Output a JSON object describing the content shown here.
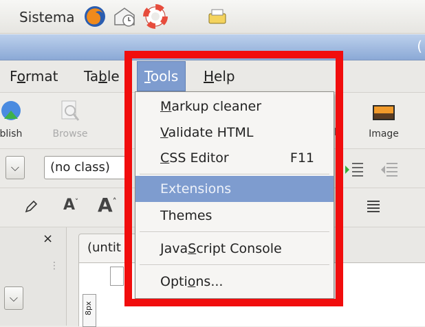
{
  "panel": {
    "system_label": "Sistema",
    "icons": [
      "firefox-icon",
      "mail-clock-icon",
      "lifebuoy-icon",
      "printer-icon"
    ]
  },
  "menubar": {
    "format": {
      "pre": "F",
      "u": "o",
      "post": "rmat"
    },
    "table": {
      "pre": "Ta",
      "u": "b",
      "post": "le"
    },
    "tools": {
      "pre": "",
      "u": "T",
      "post": "ools"
    },
    "help": {
      "pre": "",
      "u": "H",
      "post": "elp"
    }
  },
  "toolbar": {
    "publish_label": "ıblish",
    "browse_label": "Browse",
    "image_label": "Image"
  },
  "format_toolbar": {
    "class_value": "(no class)"
  },
  "tools_menu": {
    "markup_cleaner": {
      "u": "M",
      "post": "arkup cleaner"
    },
    "validate_html": {
      "u": "V",
      "post": "alidate HTML"
    },
    "css_editor": {
      "u": "C",
      "post": "SS Editor",
      "shortcut": "F11"
    },
    "extensions": {
      "label": "Extensions"
    },
    "themes": {
      "label": "Themes"
    },
    "js_console": {
      "pre": "Java",
      "u": "S",
      "post": "cript Console"
    },
    "options": {
      "pre": "Opti",
      "u": "o",
      "post": "ns..."
    }
  },
  "editor": {
    "tab_label": "(untit",
    "ruler_label": "8px"
  },
  "colors": {
    "highlight": "#7e9ccf",
    "annotation_frame": "#f10d0d",
    "titlebar": "#9ab4dd"
  }
}
